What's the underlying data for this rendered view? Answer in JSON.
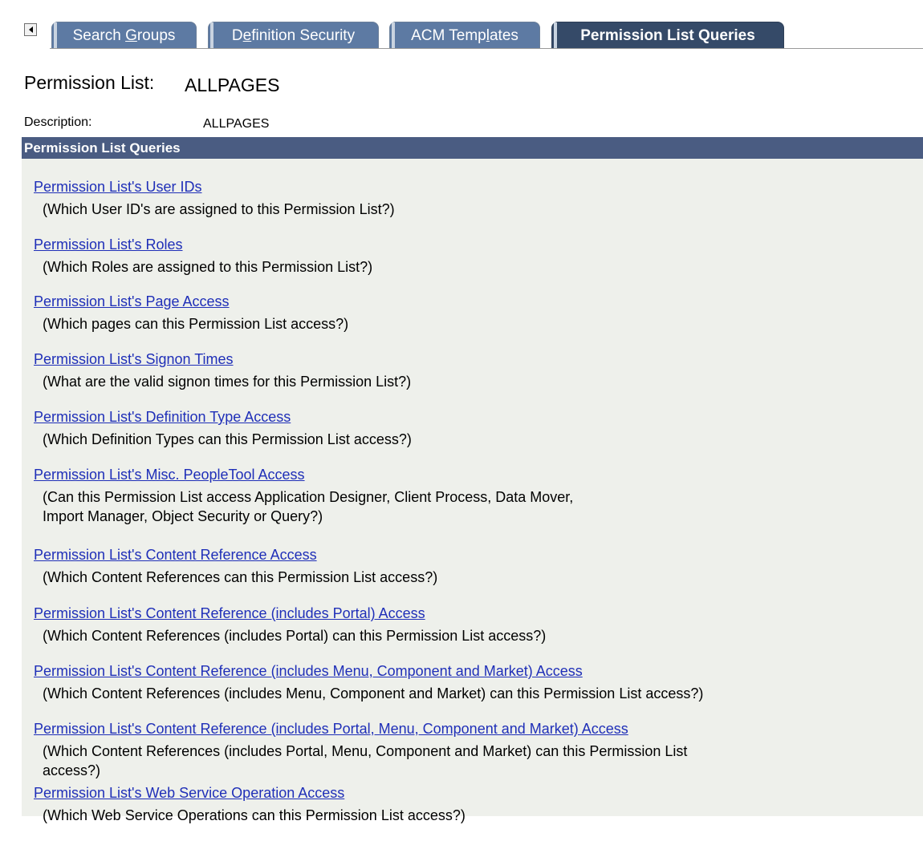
{
  "tabs": [
    {
      "label_pre": "Search ",
      "label_key": "G",
      "label_post": "roups"
    },
    {
      "label_pre": "D",
      "label_key": "e",
      "label_post": "finition Security"
    },
    {
      "label_pre": "ACM Temp",
      "label_key": "l",
      "label_post": "ates"
    },
    {
      "label_pre": "Permission List Queries",
      "label_key": "",
      "label_post": ""
    }
  ],
  "permission_list": {
    "label": "Permission List:",
    "value": "ALLPAGES"
  },
  "description": {
    "label": "Description:",
    "value": "ALLPAGES"
  },
  "grid": {
    "title": "Permission List Queries"
  },
  "queries": [
    {
      "link": "Permission List's User IDs",
      "desc": [
        "(Which User ID's are assigned to this Permission List?)"
      ]
    },
    {
      "link": "Permission List's Roles",
      "desc": [
        "(Which Roles are assigned to this Permission List?)"
      ]
    },
    {
      "link": "Permission List's Page Access",
      "desc": [
        "(Which pages can this Permission List access?)"
      ]
    },
    {
      "link": "Permission List's Signon Times",
      "desc": [
        "(What are the valid signon times for this Permission List?)"
      ]
    },
    {
      "link": "Permission List's Definition Type Access",
      "desc": [
        "(Which Definition Types can this Permission List access?)"
      ]
    },
    {
      "link": "Permission List's Misc. PeopleTool Access",
      "desc": [
        "(Can this Permission List access Application Designer, Client Process, Data Mover,",
        "Import Manager, Object Security or Query?)"
      ]
    },
    {
      "link": "Permission List's Content Reference Access",
      "desc": [
        "(Which Content References can this Permission List access?)"
      ]
    },
    {
      "link": "Permission List's Content Reference (includes Portal) Access",
      "desc": [
        "(Which Content References (includes Portal) can this Permission List access?)"
      ]
    },
    {
      "link": "Permission List's Content Reference (includes Menu, Component and Market) Access",
      "desc": [
        "(Which Content References (includes Menu, Component and Market) can this Permission List access?)"
      ]
    },
    {
      "link": "Permission List's Content Reference (includes Portal, Menu, Component and Market) Access",
      "desc": [
        "(Which Content References (includes Portal, Menu, Component and Market) can this Permission List",
        "access?)"
      ]
    },
    {
      "link": "Permission List's Web Service Operation Access",
      "desc": [
        "(Which Web Service Operations can this Permission List access?)"
      ]
    }
  ]
}
